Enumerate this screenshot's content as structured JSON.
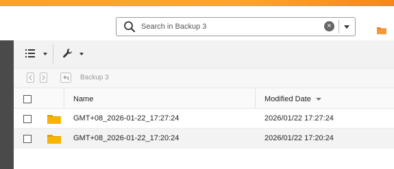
{
  "header": {
    "search": {
      "placeholder": "Search in Backup 3",
      "value": ""
    },
    "icons": {
      "search": "search-icon",
      "clear": "clear-icon",
      "dropdown": "chevron-down-icon",
      "app": "folder-icon"
    }
  },
  "toolbar": {
    "buttons": [
      {
        "name": "list-view",
        "icon": "list-icon"
      },
      {
        "name": "tools",
        "icon": "wrench-icon"
      }
    ]
  },
  "navigation": {
    "breadcrumb": "Backup 3"
  },
  "table": {
    "columns": {
      "name": "Name",
      "modified": "Modified Date"
    },
    "sort": {
      "column": "Modified Date",
      "direction": "descending"
    },
    "rows": [
      {
        "name": "GMT+08_2026-01-22_17:27:24",
        "modified": "2026/01/22 17:27:24",
        "icon": "folder-icon"
      },
      {
        "name": "GMT+08_2026-01-22_17:20:24",
        "modified": "2026/01/22 17:20:24",
        "icon": "folder-icon"
      }
    ]
  },
  "colors": {
    "accent": "#f5a623",
    "folder": "#f7b500",
    "sidebar": "#4a4a4a"
  }
}
